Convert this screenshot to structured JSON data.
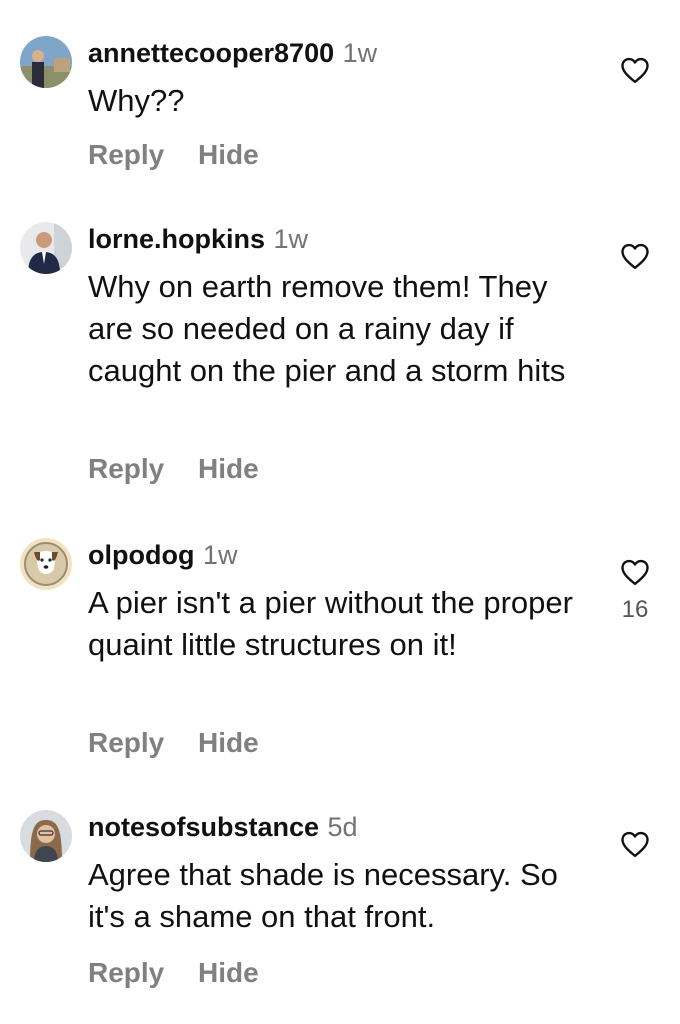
{
  "comments": [
    {
      "username": "annettecooper8700",
      "time": "1w",
      "text": "Why??",
      "reply": "Reply",
      "hide": "Hide",
      "likes": ""
    },
    {
      "username": "lorne.hopkins",
      "time": "1w",
      "text": "Why on earth remove them! They are so needed on a rainy day if caught on the pier and a storm hits",
      "reply": "Reply",
      "hide": "Hide",
      "likes": ""
    },
    {
      "username": "olpodog",
      "time": "1w",
      "text": "A pier isn't a pier without the proper quaint little structures on it!",
      "reply": "Reply",
      "hide": "Hide",
      "likes": "16"
    },
    {
      "username": "notesofsubstance",
      "time": "5d",
      "text": "Agree that shade is necessary. So it's a shame on that front.",
      "reply": "Reply",
      "hide": "Hide",
      "likes": ""
    }
  ],
  "icons": {
    "like": "heart-outline-icon"
  },
  "colors": {
    "text": "#111111",
    "muted": "#737373",
    "action": "#808080"
  }
}
